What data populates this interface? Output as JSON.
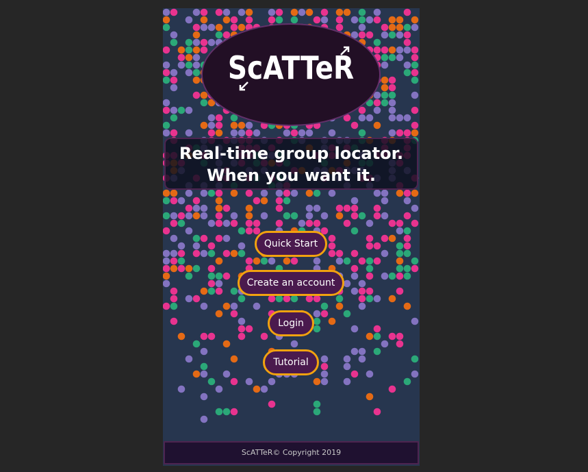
{
  "logo": {
    "text": "ScATTeR"
  },
  "tagline": {
    "line1": "Real-time group locator.",
    "line2": "When you want it."
  },
  "buttons": {
    "quick_start": "Quick Start",
    "create_account": "Create an account",
    "login": "Login",
    "tutorial": "Tutorial"
  },
  "footer": {
    "text": "ScATTeR© Copyright 2019"
  },
  "colors": {
    "background": "#27364f",
    "page": "#262626",
    "accent": "#f2a20f",
    "button_fill": "#4a1a4e",
    "dot_pink": "#e8338f",
    "dot_orange": "#e46a15",
    "dot_purple": "#8373c0",
    "dot_green": "#2ba878"
  }
}
